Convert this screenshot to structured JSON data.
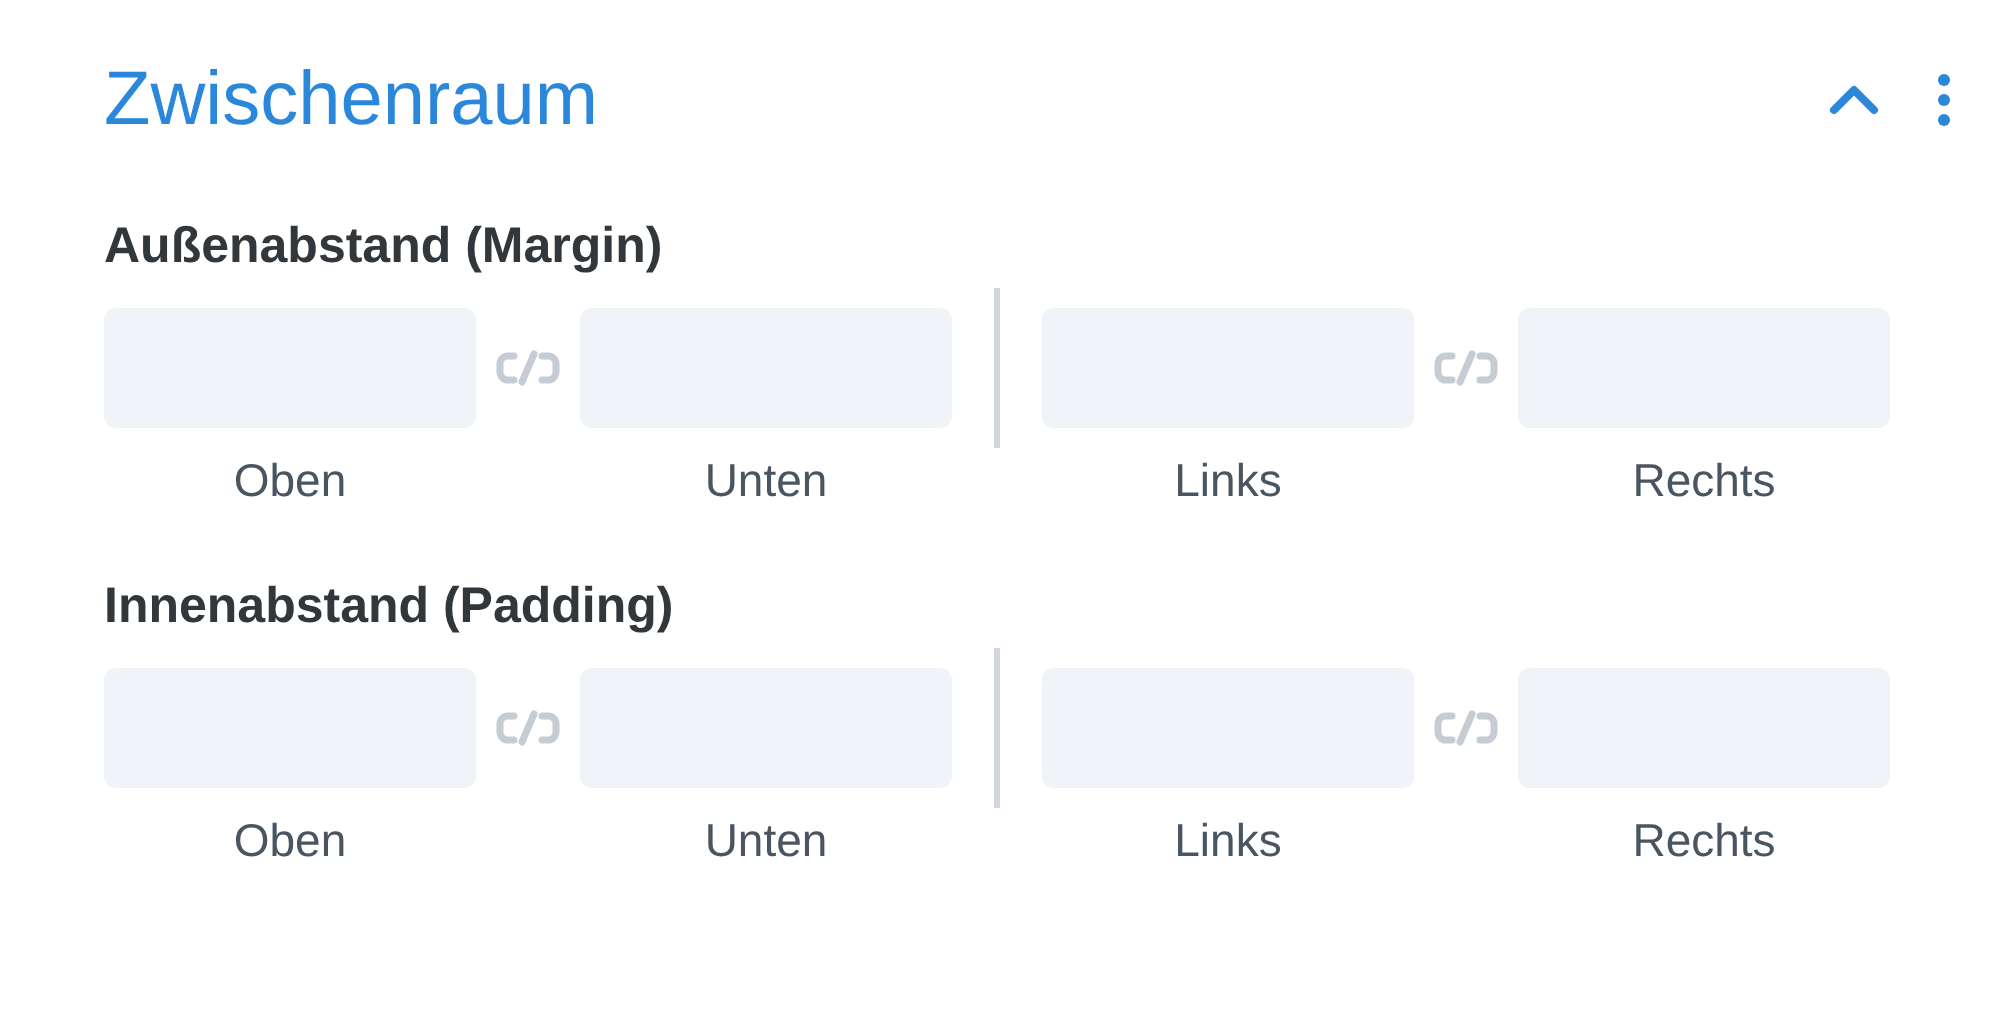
{
  "section": {
    "title": "Zwischenraum",
    "expanded": true
  },
  "groups": [
    {
      "label": "Außenabstand (Margin)",
      "pairs": [
        {
          "fields": [
            {
              "label": "Oben"
            },
            {
              "label": "Unten"
            }
          ]
        },
        {
          "fields": [
            {
              "label": "Links"
            },
            {
              "label": "Rechts"
            }
          ]
        }
      ]
    },
    {
      "label": "Innenabstand (Padding)",
      "pairs": [
        {
          "fields": [
            {
              "label": "Oben"
            },
            {
              "label": "Unten"
            }
          ]
        },
        {
          "fields": [
            {
              "label": "Links"
            },
            {
              "label": "Rechts"
            }
          ]
        }
      ]
    }
  ]
}
